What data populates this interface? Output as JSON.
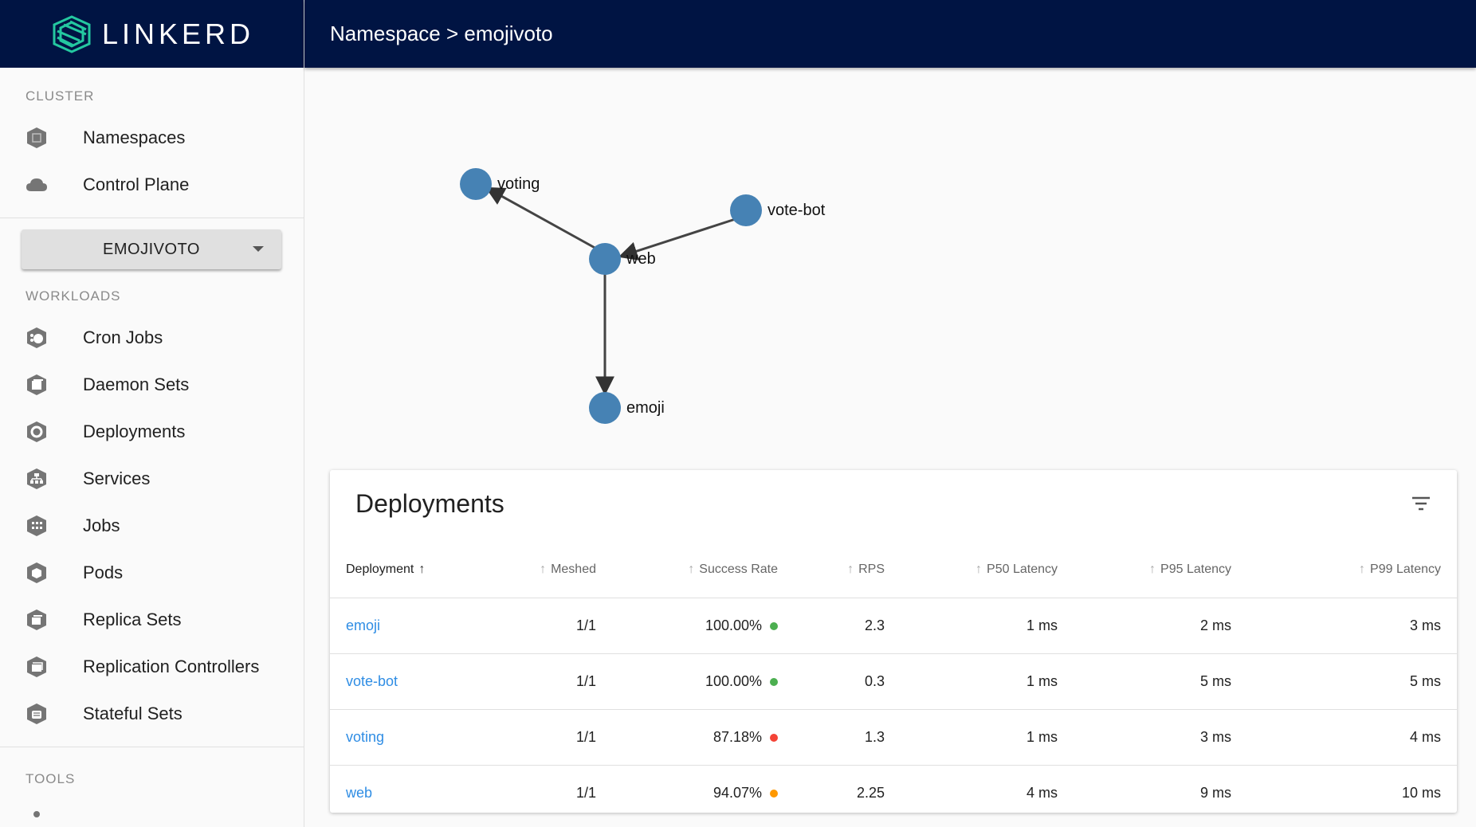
{
  "brand": {
    "name": "LINKERD"
  },
  "sidebar": {
    "cluster_label": "CLUSTER",
    "cluster_items": [
      {
        "label": "Namespaces",
        "icon": "namespace-icon"
      },
      {
        "label": "Control Plane",
        "icon": "cloud-icon"
      }
    ],
    "namespace_select": {
      "value": "EMOJIVOTO"
    },
    "workloads_label": "WORKLOADS",
    "workload_items": [
      {
        "label": "Cron Jobs",
        "icon": "cronjob-icon"
      },
      {
        "label": "Daemon Sets",
        "icon": "daemonset-icon"
      },
      {
        "label": "Deployments",
        "icon": "deployment-icon"
      },
      {
        "label": "Services",
        "icon": "service-icon"
      },
      {
        "label": "Jobs",
        "icon": "job-icon"
      },
      {
        "label": "Pods",
        "icon": "pod-icon"
      },
      {
        "label": "Replica Sets",
        "icon": "replicaset-icon"
      },
      {
        "label": "Replication Controllers",
        "icon": "replicationcontroller-icon"
      },
      {
        "label": "Stateful Sets",
        "icon": "statefulset-icon"
      }
    ],
    "tools_label": "TOOLS"
  },
  "header": {
    "breadcrumb": "Namespace > emojivoto"
  },
  "graph": {
    "nodes": [
      "voting",
      "vote-bot",
      "web",
      "emoji"
    ],
    "edges": [
      {
        "from": "web",
        "to": "voting"
      },
      {
        "from": "vote-bot",
        "to": "web"
      },
      {
        "from": "web",
        "to": "emoji"
      }
    ],
    "node_color": "#4682b4"
  },
  "deployments_table": {
    "title": "Deployments",
    "columns": [
      "Deployment",
      "Meshed",
      "Success Rate",
      "RPS",
      "P50 Latency",
      "P95 Latency",
      "P99 Latency"
    ],
    "rows": [
      {
        "name": "emoji",
        "meshed": "1/1",
        "success_rate": "100.00%",
        "status_color": "#4caf50",
        "rps": "2.3",
        "p50": "1 ms",
        "p95": "2 ms",
        "p99": "3 ms"
      },
      {
        "name": "vote-bot",
        "meshed": "1/1",
        "success_rate": "100.00%",
        "status_color": "#4caf50",
        "rps": "0.3",
        "p50": "1 ms",
        "p95": "5 ms",
        "p99": "5 ms"
      },
      {
        "name": "voting",
        "meshed": "1/1",
        "success_rate": "87.18%",
        "status_color": "#f44336",
        "rps": "1.3",
        "p50": "1 ms",
        "p95": "3 ms",
        "p99": "4 ms"
      },
      {
        "name": "web",
        "meshed": "1/1",
        "success_rate": "94.07%",
        "status_color": "#ff9800",
        "rps": "2.25",
        "p50": "4 ms",
        "p95": "9 ms",
        "p99": "10 ms"
      }
    ]
  },
  "colors": {
    "header_bg": "#001443",
    "link": "#2f8de4",
    "brand_accent": "#24c8a0"
  }
}
